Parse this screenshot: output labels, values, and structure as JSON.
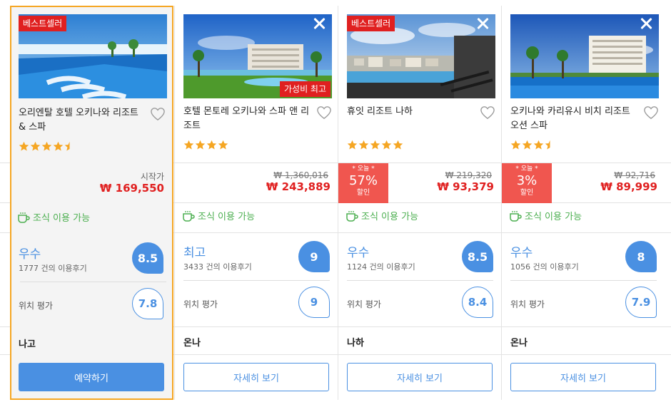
{
  "hotels": [
    {
      "name": "오리엔탈 호텔 오키나와 리조트 & 스파",
      "badge_top": "베스트셀러",
      "stars": 4.5,
      "from_label": "시작가",
      "price": "₩ 169,550",
      "breakfast": "조식 이용 가능",
      "rating_word": "우수",
      "reviews": "1777 건의 이용후기",
      "score": "8.5",
      "location_label": "위치 평가",
      "location_score": "7.8",
      "city": "나고",
      "button": "예약하기"
    },
    {
      "name": "호텔 몬토레 오키나와 스파 앤 리조트",
      "badge_bottom": "가성비 최고",
      "stars": 4,
      "original_price": "₩ 1,360,016",
      "price": "₩ 243,889",
      "breakfast": "조식 이용 가능",
      "rating_word": "최고",
      "reviews": "3433 건의 이용후기",
      "score": "9",
      "location_label": "위치 평가",
      "location_score": "9",
      "city": "온나",
      "button": "자세히 보기"
    },
    {
      "name": "휴잇 리조트 나하",
      "badge_top": "베스트셀러",
      "stars": 5,
      "discount_today": "* 오늘 *",
      "discount_pct": "57%",
      "discount_sale": "할인",
      "original_price": "₩ 219,320",
      "price": "₩ 93,379",
      "breakfast": "조식 이용 가능",
      "rating_word": "우수",
      "reviews": "1124 건의 이용후기",
      "score": "8.5",
      "location_label": "위치 평가",
      "location_score": "8.4",
      "city": "나하",
      "button": "자세히 보기"
    },
    {
      "name": "오키나와 카리유시 비치 리조트 오션 스파",
      "stars": 3.5,
      "discount_today": "* 오늘 *",
      "discount_pct": "3%",
      "discount_sale": "할인",
      "original_price": "₩ 92,716",
      "price": "₩ 89,999",
      "breakfast": "조식 이용 가능",
      "rating_word": "우수",
      "reviews": "1056 건의 이용후기",
      "score": "8",
      "location_label": "위치 평가",
      "location_score": "7.9",
      "city": "온나",
      "button": "자세히 보기"
    }
  ],
  "colors": {
    "accent": "#4a90e2",
    "price_red": "#e02020",
    "discount_red": "#f0564f",
    "star": "#f5a623",
    "breakfast_green": "#4caf50",
    "selected_border": "#f5a623"
  },
  "icons": [
    "heart-icon",
    "close-icon",
    "star-icon",
    "coffee-cup-icon"
  ]
}
